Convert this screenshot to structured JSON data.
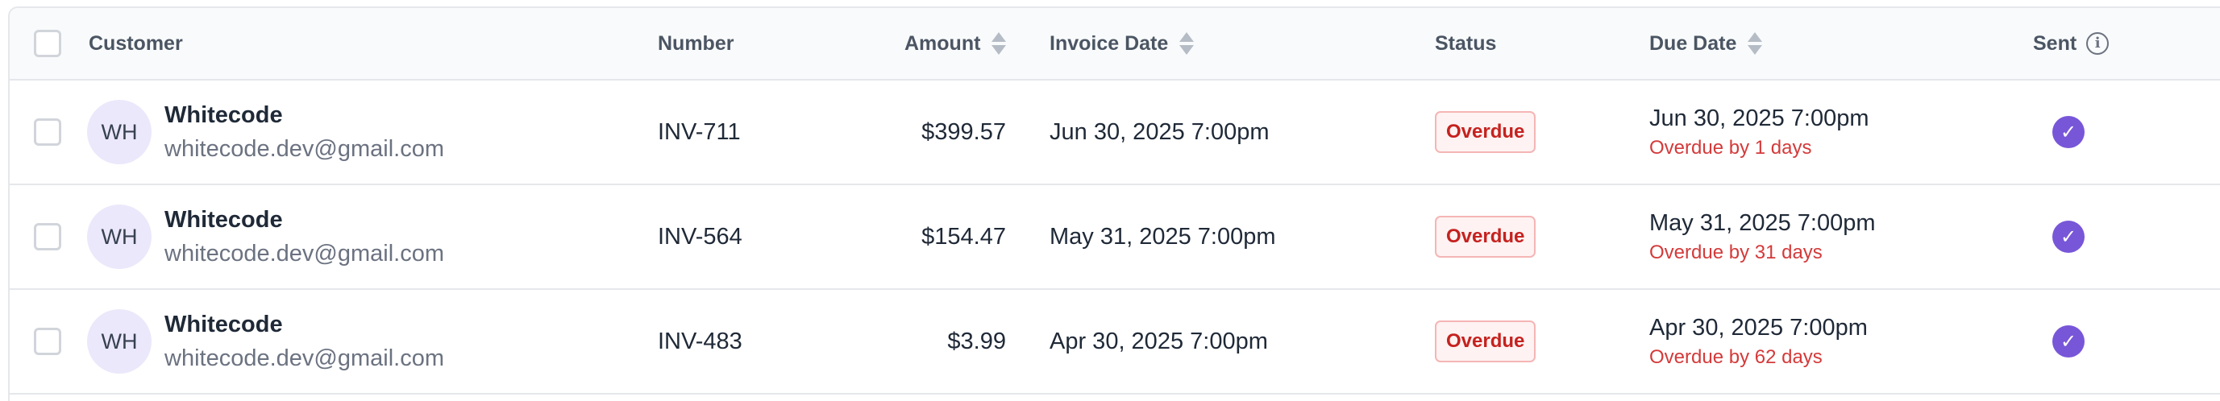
{
  "table": {
    "columns": {
      "customer": "Customer",
      "number": "Number",
      "amount": "Amount",
      "invoice_date": "Invoice Date",
      "status": "Status",
      "due_date": "Due Date",
      "sent": "Sent"
    },
    "rows": [
      {
        "avatar_initials": "WH",
        "customer_name": "Whitecode",
        "customer_email": "whitecode.dev@gmail.com",
        "number": "INV-711",
        "amount": "$399.57",
        "invoice_date": "Jun 30, 2025 7:00pm",
        "status": "Overdue",
        "due_date": "Jun 30, 2025 7:00pm",
        "overdue_note": "Overdue by 1 days",
        "sent": true
      },
      {
        "avatar_initials": "WH",
        "customer_name": "Whitecode",
        "customer_email": "whitecode.dev@gmail.com",
        "number": "INV-564",
        "amount": "$154.47",
        "invoice_date": "May 31, 2025 7:00pm",
        "status": "Overdue",
        "due_date": "May 31, 2025 7:00pm",
        "overdue_note": "Overdue by 31 days",
        "sent": true
      },
      {
        "avatar_initials": "WH",
        "customer_name": "Whitecode",
        "customer_email": "whitecode.dev@gmail.com",
        "number": "INV-483",
        "amount": "$3.99",
        "invoice_date": "Apr 30, 2025 7:00pm",
        "status": "Overdue",
        "due_date": "Apr 30, 2025 7:00pm",
        "overdue_note": "Overdue by 62 days",
        "sent": true
      }
    ]
  },
  "icons": {
    "sort": "sort-icon",
    "info": "info-icon",
    "sent": "check-circle-icon"
  },
  "colors": {
    "accent": "#7856d8",
    "overdue_text": "#c5221f",
    "overdue_bg": "#fef2f2",
    "avatar_bg": "#ebe8fb"
  }
}
